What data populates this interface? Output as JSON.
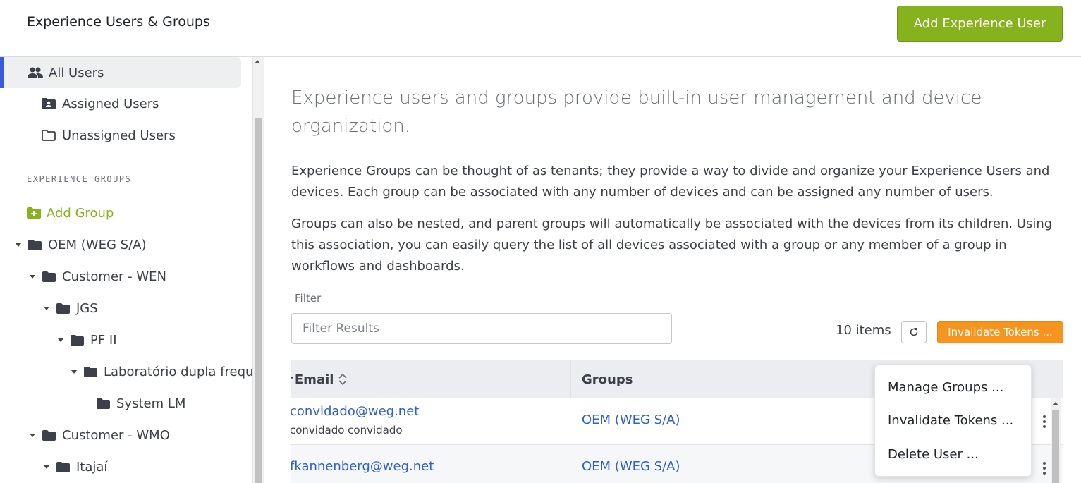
{
  "header": {
    "title": "Experience Users & Groups",
    "add_user_label": "Add Experience User"
  },
  "sidebar": {
    "items": [
      {
        "label": "All Users",
        "icon": "users-icon"
      },
      {
        "label": "Assigned Users",
        "icon": "assigned-users-folder-icon"
      },
      {
        "label": "Unassigned Users",
        "icon": "folder-outline-icon"
      }
    ],
    "section_label": "EXPERIENCE GROUPS",
    "add_group_label": "Add Group",
    "tree": [
      {
        "label": "OEM (WEG S/A)"
      },
      {
        "label": "Customer - WEN"
      },
      {
        "label": "JGS"
      },
      {
        "label": "PF II"
      },
      {
        "label": "Laboratório dupla frequ"
      },
      {
        "label": "System LM"
      },
      {
        "label": "Customer - WMO"
      },
      {
        "label": "Itajaí"
      }
    ]
  },
  "main": {
    "intro": "Experience users and groups provide built-in user management and device organization.",
    "para1": "Experience Groups can be thought of as tenants; they provide a way to divide and organize your Experience Users and devices. Each group can be associated with any number of devices and can be assigned any number of users.",
    "para2": "Groups can also be nested, and parent groups will automatically be associated with the devices from its children. Using this association, you can easily query the list of all devices associated with a group or any member of a group in workflows and dashboards.",
    "filter_label": "Filter",
    "filter_placeholder": "Filter Results",
    "items_count": "10 items",
    "invalidate_label": "Invalidate Tokens ..."
  },
  "table": {
    "columns": [
      "Email",
      "Groups"
    ],
    "rows": [
      {
        "email": "convidado@weg.net",
        "name": "convidado convidado",
        "group": "OEM (WEG S/A)"
      },
      {
        "email": "fkannenberg@weg.net",
        "name": "",
        "group": "OEM (WEG S/A)"
      }
    ]
  },
  "context_menu": {
    "items": [
      "Manage Groups ...",
      "Invalidate Tokens ...",
      "Delete User ..."
    ]
  },
  "colors": {
    "brand_green": "#86b21d",
    "warning_orange": "#f7941d",
    "link_blue": "#2f5fd0",
    "active_accent": "#3c5bd8"
  }
}
